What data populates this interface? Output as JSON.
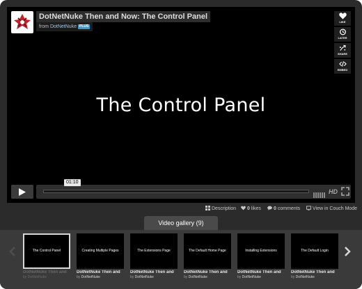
{
  "video": {
    "title": "DotNetNuke Then and Now: The Control Panel",
    "from_prefix": "from",
    "author": "DotNetNuke",
    "badge": "PLUS",
    "caption": "The Control Panel",
    "timecode": "01:10",
    "hd_label": "HD",
    "logo_text": "DotNetNuke"
  },
  "side_buttons": {
    "like": "LIKE",
    "later": "LATER",
    "share": "SHARE",
    "embed": "EMBED"
  },
  "meta": {
    "description": "Description",
    "likes_count": "0",
    "likes_label": "likes",
    "comments_count": "0",
    "comments_label": "comments",
    "couch_mode": "View in Couch Mode"
  },
  "gallery": {
    "tab_label": "Video gallery (9)",
    "thumbs": [
      {
        "caption": "The Control Panel",
        "title": "DotNetNuke Then and",
        "by": "by",
        "author": "DotNetNuke"
      },
      {
        "caption": "Creating Multiple Pages",
        "title": "DotNetNuke Then and",
        "by": "by",
        "author": "DotNetNuke"
      },
      {
        "caption": "The Extensions Page",
        "title": "DotNetNuke Then and",
        "by": "by",
        "author": "DotNetNuke"
      },
      {
        "caption": "The Default Home Page",
        "title": "DotNetNuke Then and",
        "by": "by",
        "author": "DotNetNuke"
      },
      {
        "caption": "Installing Extensions",
        "title": "DotNetNuke Then and",
        "by": "by",
        "author": "DotNetNuke"
      },
      {
        "caption": "The Default Login",
        "title": "DotNetNuke Then and",
        "by": "by",
        "author": "DotNetNuke"
      }
    ]
  },
  "colors": {
    "frame_bg": "#2b2b2b",
    "player_bg": "#000000",
    "badge_blue": "#3a9ad9",
    "author_link": "#9fc3e7"
  }
}
